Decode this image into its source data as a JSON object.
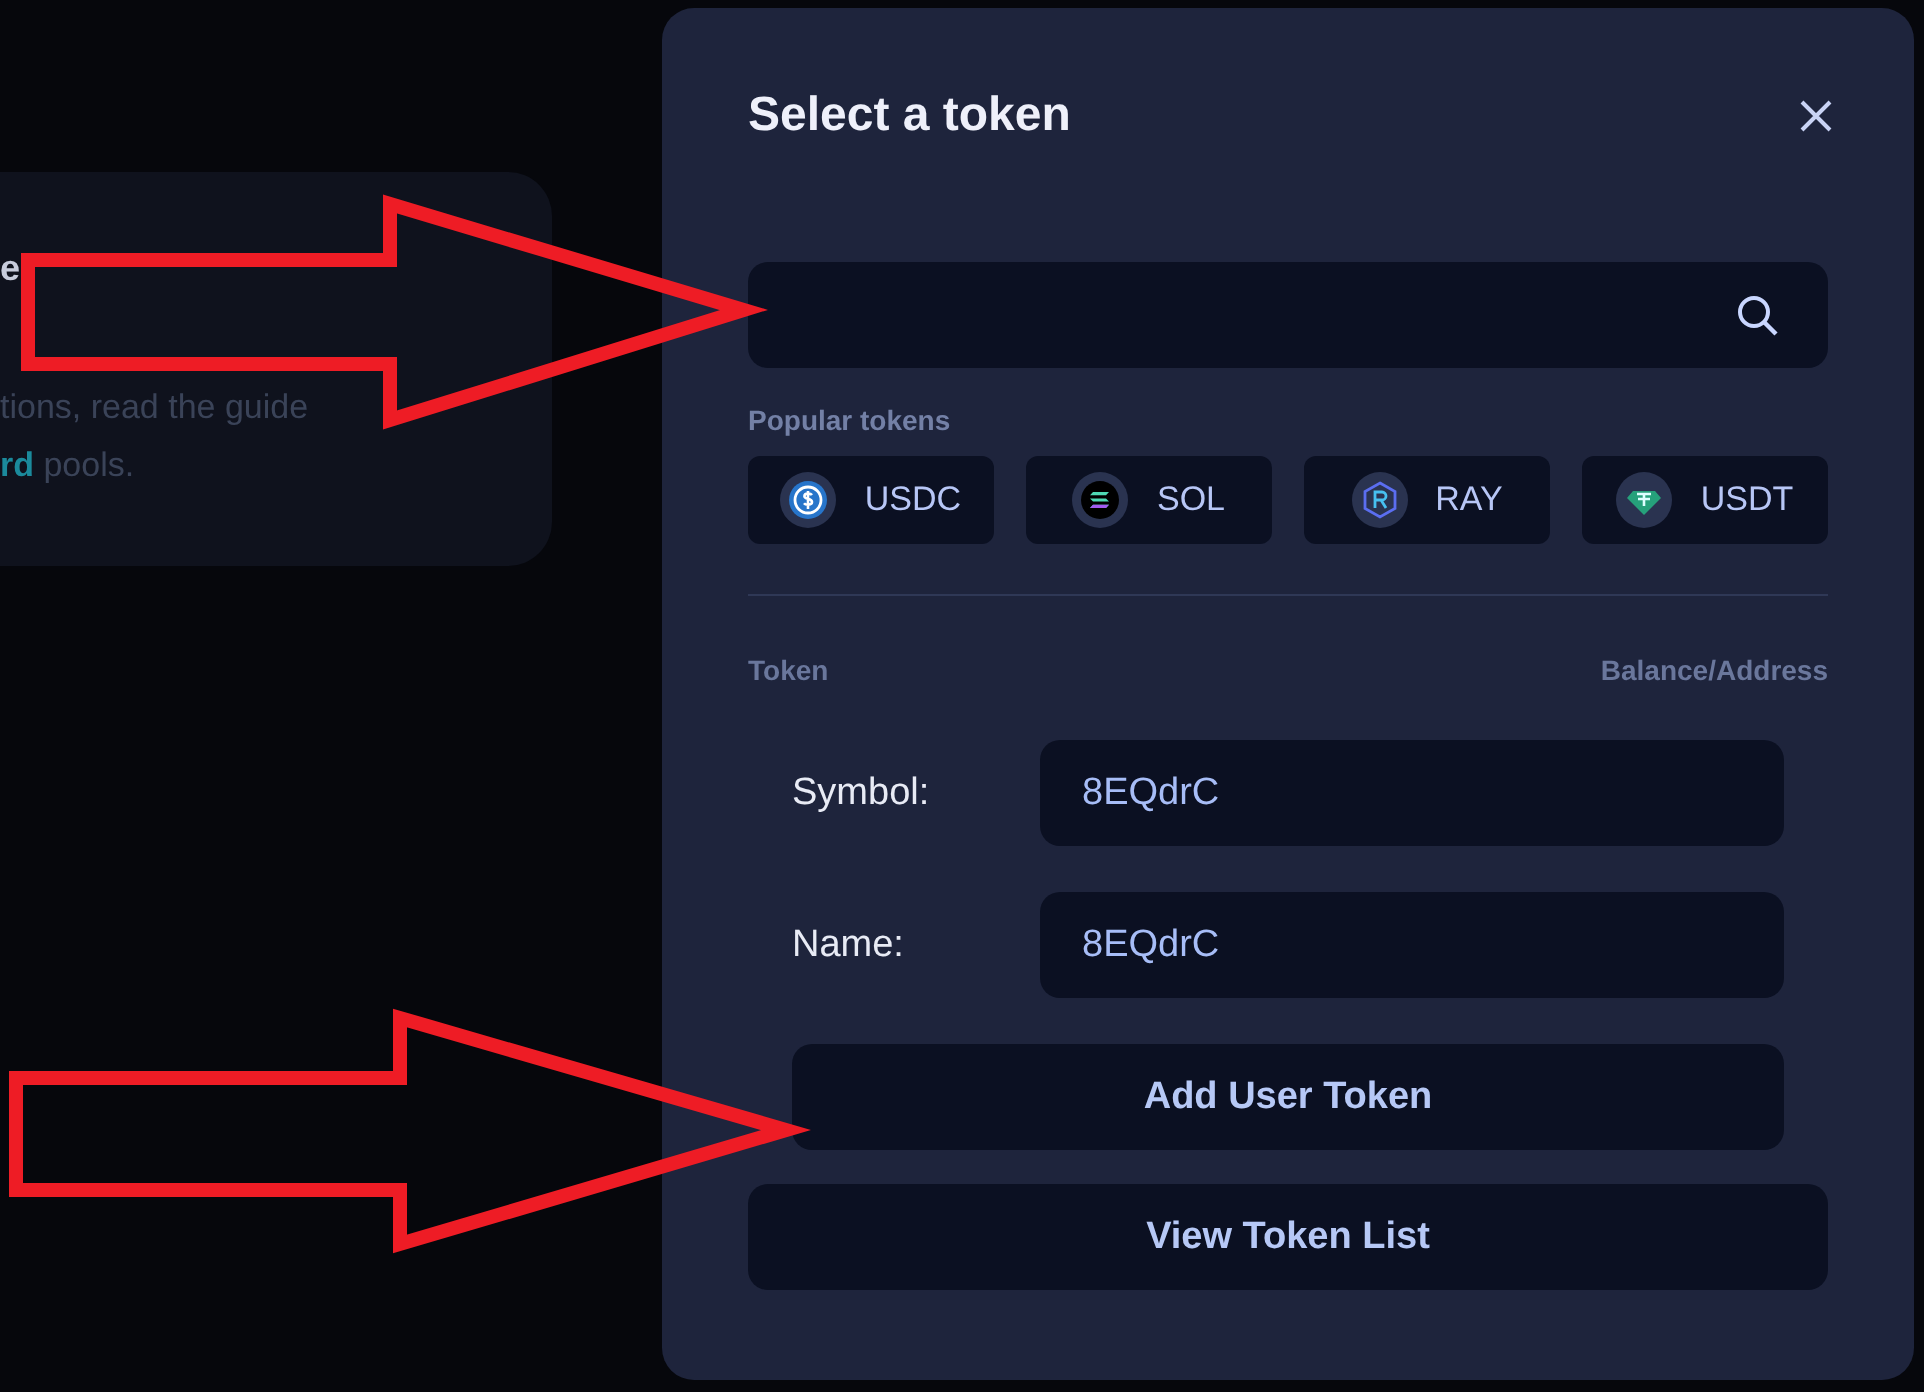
{
  "background_card": {
    "heading": "e",
    "lines": [
      "tions, read the guide"
    ],
    "last_line": "**rd** pools."
  },
  "dialog": {
    "title": "Select a token",
    "popular_label": "Popular tokens",
    "popular_tokens": [
      {
        "symbol": "USDC",
        "kind": "usdc"
      },
      {
        "symbol": "SOL",
        "kind": "sol"
      },
      {
        "symbol": "RAY",
        "kind": "ray"
      },
      {
        "symbol": "USDT",
        "kind": "usdt"
      }
    ],
    "columns": [
      "Token",
      "Balance/Address"
    ],
    "fields": [
      {
        "label": "Symbol:",
        "value": "8EQdrC"
      },
      {
        "label": "Name:",
        "value": "8EQdrC"
      }
    ],
    "add_button": "Add User Token",
    "view_button": "View Token List"
  }
}
